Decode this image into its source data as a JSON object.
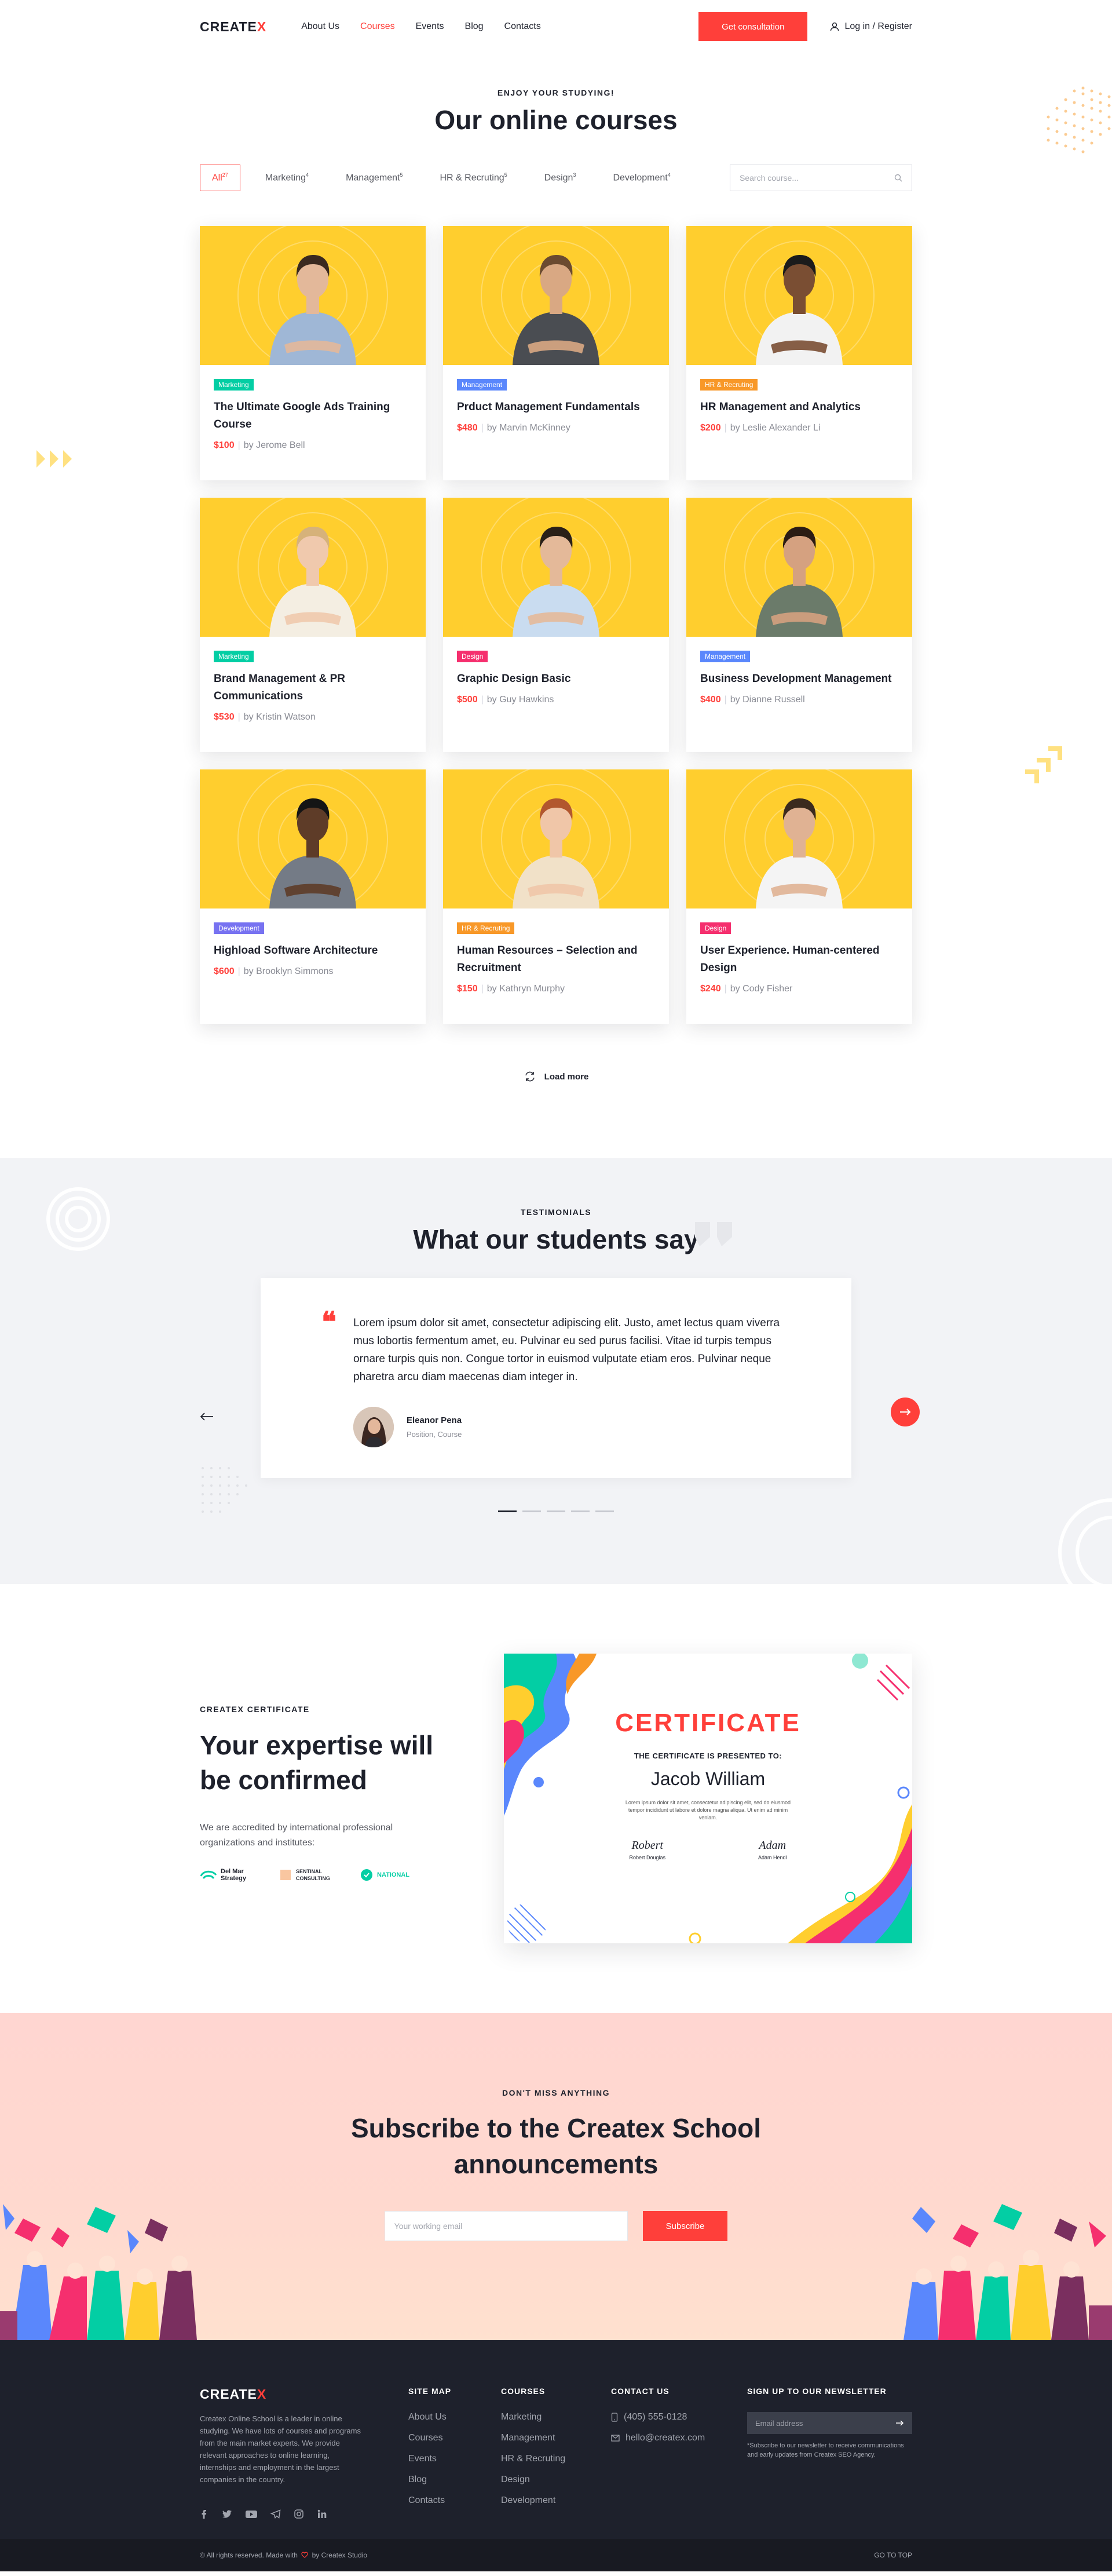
{
  "header": {
    "logo": "CREATEX",
    "nav": [
      "About Us",
      "Courses",
      "Events",
      "Blog",
      "Contacts"
    ],
    "active_nav": "Courses",
    "cta": "Get consultation",
    "login": "Log in / Register"
  },
  "courses": {
    "eyebrow": "Enjoy your studying!",
    "title": "Our online courses",
    "filters": [
      {
        "label": "All",
        "count": "27"
      },
      {
        "label": "Marketing",
        "count": "4"
      },
      {
        "label": "Management",
        "count": "5"
      },
      {
        "label": "HR & Recruting",
        "count": "5"
      },
      {
        "label": "Design",
        "count": "3"
      },
      {
        "label": "Development",
        "count": "4"
      }
    ],
    "search_placeholder": "Search course...",
    "items": [
      {
        "tag": "Marketing",
        "title": "The Ultimate Google Ads Training Course",
        "price": "$100",
        "author": "by Jerome Bell"
      },
      {
        "tag": "Management",
        "title": "Prduct Management Fundamentals",
        "price": "$480",
        "author": "by Marvin McKinney"
      },
      {
        "tag": "HR & Recruting",
        "title": "HR  Management and Analytics",
        "price": "$200",
        "author": "by Leslie Alexander Li"
      },
      {
        "tag": "Marketing",
        "title": "Brand Management & PR Communications",
        "price": "$530",
        "author": "by Kristin Watson"
      },
      {
        "tag": "Design",
        "title": "Graphic Design Basic",
        "price": "$500",
        "author": "by Guy Hawkins"
      },
      {
        "tag": "Management",
        "title": "Business Development Management",
        "price": "$400",
        "author": "by Dianne Russell"
      },
      {
        "tag": "Development",
        "title": "Highload Software Architecture",
        "price": "$600",
        "author": "by Brooklyn Simmons"
      },
      {
        "tag": "HR & Recruting",
        "title": "Human Resources – Selection and Recruitment",
        "price": "$150",
        "author": "by Kathryn Murphy"
      },
      {
        "tag": "Design",
        "title": "User Experience. Human-centered Design",
        "price": "$240",
        "author": "by Cody Fisher"
      }
    ],
    "tag_colors": {
      "Marketing": "#03cea4",
      "Management": "#5a87fc",
      "HR & Recruting": "#f89828",
      "Design": "#f52f6e",
      "Development": "#7772f1"
    },
    "load_more": "Load more"
  },
  "testimonials": {
    "eyebrow": "Testimonials",
    "title": "What our students say",
    "text": "Lorem ipsum dolor sit amet, consectetur adipiscing elit. Justo, amet lectus quam viverra mus lobortis fermentum amet, eu. Pulvinar eu sed purus facilisi. Vitae id turpis tempus ornare turpis quis non. Congue tortor in euismod vulputate etiam eros. Pulvinar neque pharetra arcu diam maecenas diam integer in.",
    "author": "Eleanor Pena",
    "position": "Position, Course"
  },
  "certificate": {
    "eyebrow": "Createx Certificate",
    "title": "Your expertise will be confirmed",
    "accredited": "We are accredited by international professional organizations and institutes:",
    "partners": [
      "Del Mar Strategy",
      "SENTINAL CONSULTING",
      "NATIONAL"
    ],
    "doc": {
      "heading": "CERTIFICATE",
      "presented": "THE CERTIFICATE IS PRESENTED TO:",
      "name": "Jacob William",
      "body": "Lorem ipsum dolor sit amet, consectetur adipiscing elit, sed do eiusmod tempor incididunt ut labore et dolore magna aliqua. Ut enim ad minim veniam.",
      "sig1_script": "Robert",
      "sig1": "Robert Douglas",
      "sig2_script": "Adam",
      "sig2": "Adam Hendl"
    }
  },
  "subscribe": {
    "eyebrow": "Don't miss anything",
    "title": "Subscribe to the Createx School announcements",
    "placeholder": "Your working email",
    "button": "Subscribe"
  },
  "footer": {
    "logo": "CREATEX",
    "description": "Createx Online School is a leader in online studying. We have lots of courses and programs from the main market experts. We provide relevant approaches to online learning, internships and employment in the largest companies in the country.",
    "sitemap_title": "Site map",
    "sitemap": [
      "About Us",
      "Courses",
      "Events",
      "Blog",
      "Contacts"
    ],
    "courses_title": "Courses",
    "courses": [
      "Marketing",
      "Management",
      "HR & Recruting",
      "Design",
      "Development"
    ],
    "contact_title": "Contact us",
    "phone": "(405) 555-0128",
    "email": "hello@createx.com",
    "newsletter_title": "Sign up to our newsletter",
    "newsletter_placeholder": "Email address",
    "newsletter_note": "*Subscribe to our newsletter to receive communications and early updates from Createx SEO Agency.",
    "copyright_left": "© All rights reserved. Made with",
    "copyright_right": "by Createx Studio",
    "go_top": "GO TO TOP"
  }
}
